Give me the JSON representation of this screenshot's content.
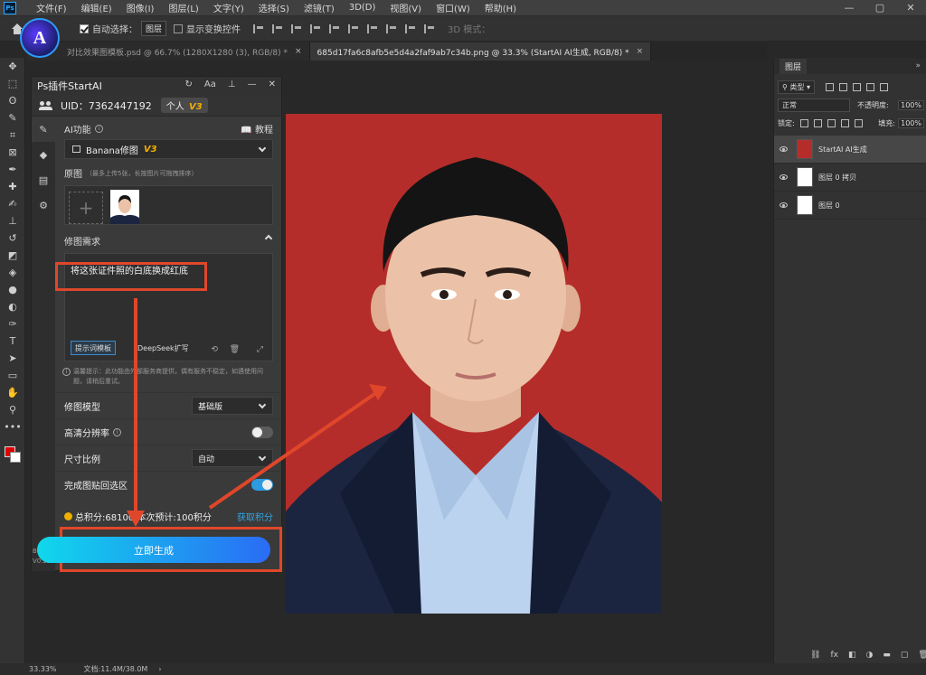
{
  "menu": {
    "logo": "Ps",
    "items": [
      "文件(F)",
      "编辑(E)",
      "图像(I)",
      "图层(L)",
      "文字(Y)",
      "选择(S)",
      "滤镜(T)",
      "3D(D)",
      "视图(V)",
      "窗口(W)",
      "帮助(H)"
    ],
    "window_controls": [
      "—",
      "▢",
      "✕"
    ]
  },
  "options": {
    "auto_select_label": "自动选择：",
    "auto_select_value": "图层",
    "show_transform_label": "显示变换控件",
    "mode_3d_label": "3D 模式："
  },
  "logo_badge": "A",
  "tabs": [
    {
      "label": "对比效果图模板.psd @ 66.7% (1280X1280 (3), RGB/8) *",
      "close": "×",
      "active": false
    },
    {
      "label": "685d17fa6c8afb5e5d4a2faf9ab7c34b.png @ 33.3% (StartAI AI生成, RGB/8) *",
      "close": "×",
      "active": true
    }
  ],
  "toolbar": {
    "tools": [
      {
        "name": "move-tool-icon",
        "glyph": "✥"
      },
      {
        "name": "marquee-tool-icon",
        "glyph": "⬚"
      },
      {
        "name": "lasso-tool-icon",
        "glyph": "ʘ"
      },
      {
        "name": "quick-select-tool-icon",
        "glyph": "✎"
      },
      {
        "name": "crop-tool-icon",
        "glyph": "⌗"
      },
      {
        "name": "frame-tool-icon",
        "glyph": "⊠"
      },
      {
        "name": "eyedropper-tool-icon",
        "glyph": "✒"
      },
      {
        "name": "healing-tool-icon",
        "glyph": "✚"
      },
      {
        "name": "brush-tool-icon",
        "glyph": "✍"
      },
      {
        "name": "stamp-tool-icon",
        "glyph": "⊥"
      },
      {
        "name": "history-brush-tool-icon",
        "glyph": "↺"
      },
      {
        "name": "eraser-tool-icon",
        "glyph": "◩"
      },
      {
        "name": "bucket-tool-icon",
        "glyph": "◈"
      },
      {
        "name": "blur-tool-icon",
        "glyph": "●"
      },
      {
        "name": "dodge-tool-icon",
        "glyph": "◐"
      },
      {
        "name": "pen-tool-icon",
        "glyph": "✑"
      },
      {
        "name": "type-tool-icon",
        "glyph": "T"
      },
      {
        "name": "path-select-tool-icon",
        "glyph": "➤"
      },
      {
        "name": "shape-tool-icon",
        "glyph": "▭"
      },
      {
        "name": "hand-tool-icon",
        "glyph": "✋"
      },
      {
        "name": "zoom-tool-icon",
        "glyph": "⚲"
      },
      {
        "name": "more-tools-icon",
        "glyph": "•••"
      }
    ],
    "fg_color": "#e00000",
    "bg_color": "#ffffff"
  },
  "plugin": {
    "title": "Ps插件StartAI",
    "title_icons": [
      "↻",
      "Aa",
      "⊥",
      "—",
      "✕"
    ],
    "uid_label": "UID：7362447192",
    "plan_label": "个人",
    "plan_badge": "V3",
    "side_icons": [
      "✎",
      "◆",
      "▤",
      "⚙"
    ],
    "ai_function_label": "AI功能",
    "tutorial_label": "教程",
    "function_select": "Banana修图",
    "function_badge": "V3",
    "source_label": "原图",
    "source_note": "（最多上传5张，长按图片可拖拽排序）",
    "plus_glyph": "+",
    "requirement_label": "修图需求",
    "requirement_text": "将这张证件照的白底换成红底",
    "prompt_template_btn": "提示词模板",
    "deepseek_btn": "DeepSeek扩写",
    "tip_text": "温馨提示：此功能由外部服务商提供，偶有服务不稳定，如遇使用问题，请稍后重试。",
    "model_label": "修图模型",
    "model_value": "基础版",
    "hires_label": "高清分辨率",
    "ratio_label": "尺寸比例",
    "ratio_value": "自动",
    "paste_back_label": "完成图贴回选区",
    "points_text": "总积分:68100 本次预计:100积分",
    "get_points": "获取积分",
    "generate_btn": "立即生成",
    "beta_label": "Beta",
    "version": "V0.25.3",
    "accent": "#2d9be0"
  },
  "layers": {
    "tab_label": "图层",
    "more_label": "»",
    "filter_label": "类型",
    "blend_mode": "正常",
    "opacity_label": "不透明度:",
    "opacity_value": "100%",
    "lock_label": "锁定:",
    "fill_label": "填充:",
    "fill_value": "100%",
    "items": [
      {
        "name": "StartAI AI生成",
        "active": true
      },
      {
        "name": "图层 0 拷贝",
        "active": false
      },
      {
        "name": "图层 0",
        "active": false
      }
    ],
    "footer_icons": [
      "⛓",
      "fx",
      "◧",
      "◑",
      "▬",
      "▢",
      "🗑"
    ]
  },
  "status": {
    "zoom": "33.33%",
    "doc": "文档:11.4M/38.0M",
    "arrow": "›"
  },
  "photo": {
    "bg_color": "#b52d2a"
  }
}
